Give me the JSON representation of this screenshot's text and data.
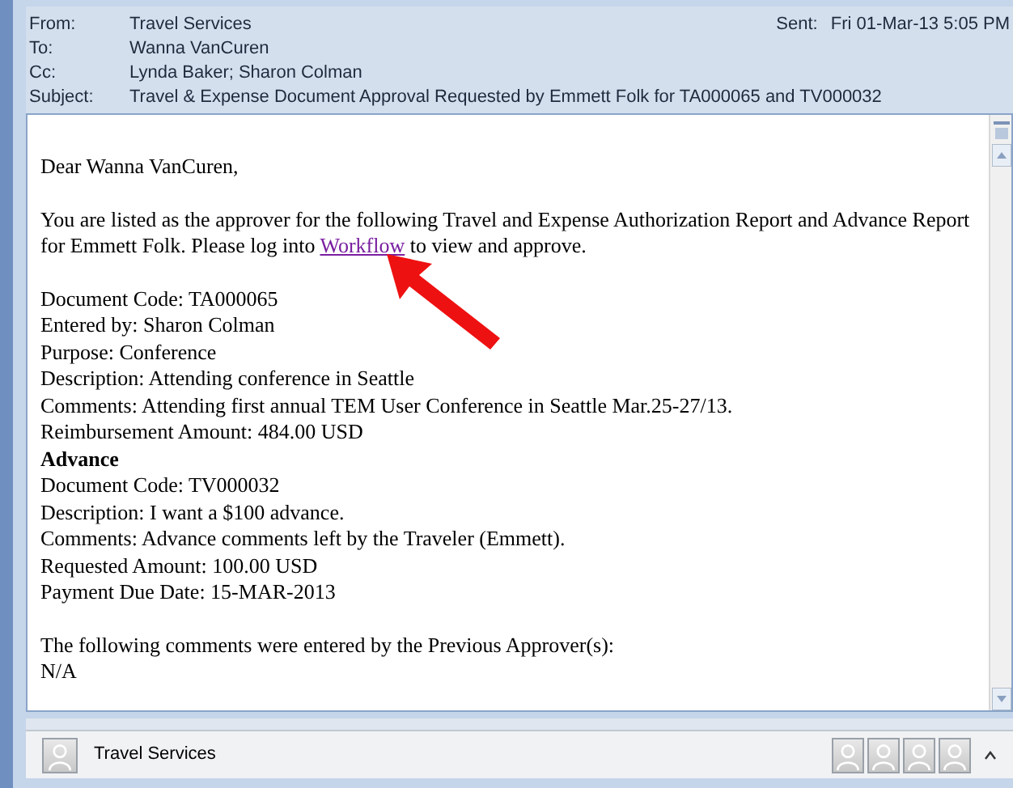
{
  "header": {
    "fields": [
      {
        "label": "From:",
        "value": "Travel Services"
      },
      {
        "label": "To:",
        "value": "Wanna VanCuren"
      },
      {
        "label": "Cc:",
        "value": "Lynda Baker; Sharon Colman"
      },
      {
        "label": "Subject:",
        "value": "Travel & Expense Document Approval Requested by Emmett Folk for TA000065 and TV000032"
      }
    ],
    "sent": {
      "label": "Sent:",
      "value": "Fri 01-Mar-13 5:05 PM"
    }
  },
  "body": {
    "greeting": "Dear Wanna VanCuren,",
    "intro_before": "You are listed as the approver for the following Travel and Expense Authorization Report and Advance Report for Emmett Folk. Please log into",
    "link": "Workflow",
    "intro_after": "to view and approve.",
    "lines": [
      {
        "kind": "text",
        "text": "Document Code: TA000065"
      },
      {
        "kind": "text",
        "text": "Entered by: Sharon Colman"
      },
      {
        "kind": "text",
        "text": "Purpose: Conference"
      },
      {
        "kind": "text",
        "text": "Description: Attending conference in Seattle"
      },
      {
        "kind": "text",
        "text": "Comments: Attending first annual TEM User Conference in Seattle Mar.25-27/13."
      },
      {
        "kind": "text",
        "text": "Reimbursement Amount: 484.00 USD"
      },
      {
        "kind": "heading",
        "text": "Advance"
      },
      {
        "kind": "text",
        "text": "Document Code: TV000032"
      },
      {
        "kind": "text",
        "text": "Description: I want a $100 advance."
      },
      {
        "kind": "text",
        "text": "Comments: Advance comments left by the Traveler (Emmett)."
      },
      {
        "kind": "text",
        "text": "Requested Amount: 100.00 USD"
      },
      {
        "kind": "text",
        "text": "Payment Due Date: 15-MAR-2013"
      }
    ],
    "closing": [
      "The following comments were entered by the Previous Approver(s):",
      "N/A"
    ]
  },
  "people_pane": {
    "name": "Travel Services"
  }
}
